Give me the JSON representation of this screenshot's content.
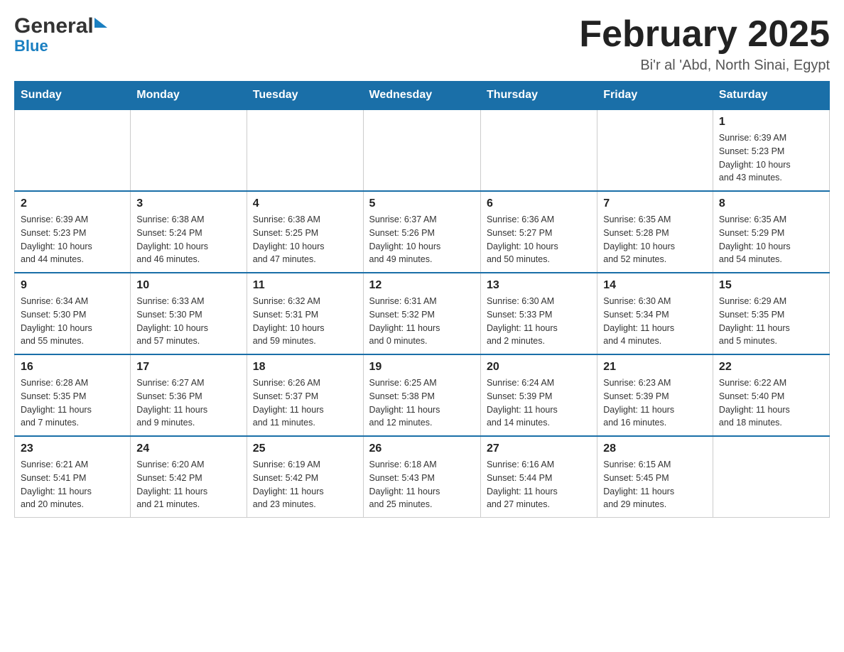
{
  "header": {
    "logo_general": "General",
    "logo_blue": "Blue",
    "month_title": "February 2025",
    "location": "Bi'r al 'Abd, North Sinai, Egypt"
  },
  "days_of_week": [
    "Sunday",
    "Monday",
    "Tuesday",
    "Wednesday",
    "Thursday",
    "Friday",
    "Saturday"
  ],
  "weeks": [
    [
      {
        "day": "",
        "info": ""
      },
      {
        "day": "",
        "info": ""
      },
      {
        "day": "",
        "info": ""
      },
      {
        "day": "",
        "info": ""
      },
      {
        "day": "",
        "info": ""
      },
      {
        "day": "",
        "info": ""
      },
      {
        "day": "1",
        "info": "Sunrise: 6:39 AM\nSunset: 5:23 PM\nDaylight: 10 hours\nand 43 minutes."
      }
    ],
    [
      {
        "day": "2",
        "info": "Sunrise: 6:39 AM\nSunset: 5:23 PM\nDaylight: 10 hours\nand 44 minutes."
      },
      {
        "day": "3",
        "info": "Sunrise: 6:38 AM\nSunset: 5:24 PM\nDaylight: 10 hours\nand 46 minutes."
      },
      {
        "day": "4",
        "info": "Sunrise: 6:38 AM\nSunset: 5:25 PM\nDaylight: 10 hours\nand 47 minutes."
      },
      {
        "day": "5",
        "info": "Sunrise: 6:37 AM\nSunset: 5:26 PM\nDaylight: 10 hours\nand 49 minutes."
      },
      {
        "day": "6",
        "info": "Sunrise: 6:36 AM\nSunset: 5:27 PM\nDaylight: 10 hours\nand 50 minutes."
      },
      {
        "day": "7",
        "info": "Sunrise: 6:35 AM\nSunset: 5:28 PM\nDaylight: 10 hours\nand 52 minutes."
      },
      {
        "day": "8",
        "info": "Sunrise: 6:35 AM\nSunset: 5:29 PM\nDaylight: 10 hours\nand 54 minutes."
      }
    ],
    [
      {
        "day": "9",
        "info": "Sunrise: 6:34 AM\nSunset: 5:30 PM\nDaylight: 10 hours\nand 55 minutes."
      },
      {
        "day": "10",
        "info": "Sunrise: 6:33 AM\nSunset: 5:30 PM\nDaylight: 10 hours\nand 57 minutes."
      },
      {
        "day": "11",
        "info": "Sunrise: 6:32 AM\nSunset: 5:31 PM\nDaylight: 10 hours\nand 59 minutes."
      },
      {
        "day": "12",
        "info": "Sunrise: 6:31 AM\nSunset: 5:32 PM\nDaylight: 11 hours\nand 0 minutes."
      },
      {
        "day": "13",
        "info": "Sunrise: 6:30 AM\nSunset: 5:33 PM\nDaylight: 11 hours\nand 2 minutes."
      },
      {
        "day": "14",
        "info": "Sunrise: 6:30 AM\nSunset: 5:34 PM\nDaylight: 11 hours\nand 4 minutes."
      },
      {
        "day": "15",
        "info": "Sunrise: 6:29 AM\nSunset: 5:35 PM\nDaylight: 11 hours\nand 5 minutes."
      }
    ],
    [
      {
        "day": "16",
        "info": "Sunrise: 6:28 AM\nSunset: 5:35 PM\nDaylight: 11 hours\nand 7 minutes."
      },
      {
        "day": "17",
        "info": "Sunrise: 6:27 AM\nSunset: 5:36 PM\nDaylight: 11 hours\nand 9 minutes."
      },
      {
        "day": "18",
        "info": "Sunrise: 6:26 AM\nSunset: 5:37 PM\nDaylight: 11 hours\nand 11 minutes."
      },
      {
        "day": "19",
        "info": "Sunrise: 6:25 AM\nSunset: 5:38 PM\nDaylight: 11 hours\nand 12 minutes."
      },
      {
        "day": "20",
        "info": "Sunrise: 6:24 AM\nSunset: 5:39 PM\nDaylight: 11 hours\nand 14 minutes."
      },
      {
        "day": "21",
        "info": "Sunrise: 6:23 AM\nSunset: 5:39 PM\nDaylight: 11 hours\nand 16 minutes."
      },
      {
        "day": "22",
        "info": "Sunrise: 6:22 AM\nSunset: 5:40 PM\nDaylight: 11 hours\nand 18 minutes."
      }
    ],
    [
      {
        "day": "23",
        "info": "Sunrise: 6:21 AM\nSunset: 5:41 PM\nDaylight: 11 hours\nand 20 minutes."
      },
      {
        "day": "24",
        "info": "Sunrise: 6:20 AM\nSunset: 5:42 PM\nDaylight: 11 hours\nand 21 minutes."
      },
      {
        "day": "25",
        "info": "Sunrise: 6:19 AM\nSunset: 5:42 PM\nDaylight: 11 hours\nand 23 minutes."
      },
      {
        "day": "26",
        "info": "Sunrise: 6:18 AM\nSunset: 5:43 PM\nDaylight: 11 hours\nand 25 minutes."
      },
      {
        "day": "27",
        "info": "Sunrise: 6:16 AM\nSunset: 5:44 PM\nDaylight: 11 hours\nand 27 minutes."
      },
      {
        "day": "28",
        "info": "Sunrise: 6:15 AM\nSunset: 5:45 PM\nDaylight: 11 hours\nand 29 minutes."
      },
      {
        "day": "",
        "info": ""
      }
    ]
  ]
}
